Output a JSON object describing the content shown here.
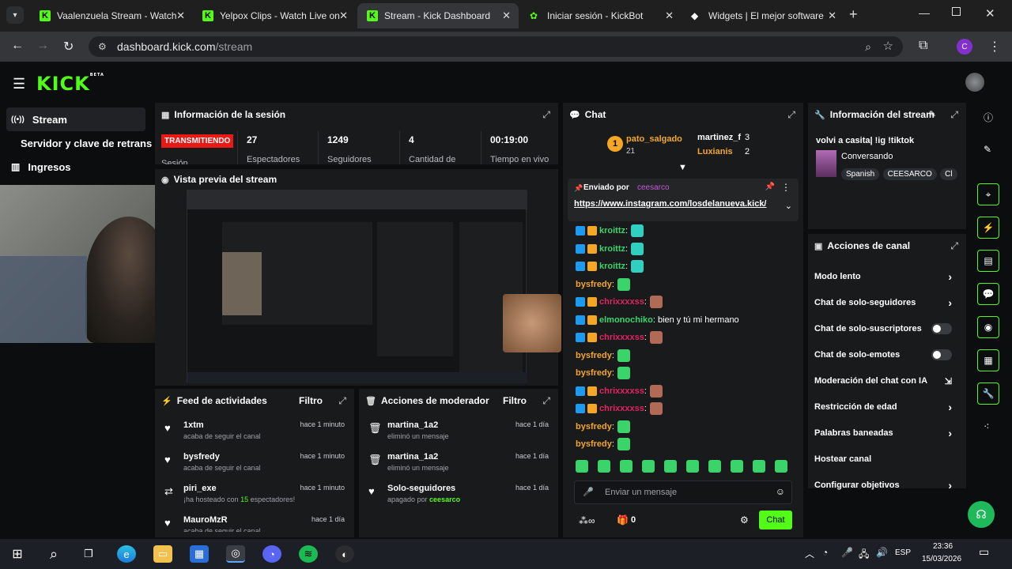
{
  "browser": {
    "tabs": [
      {
        "title": "Vaalenzuela Stream - Watch",
        "fav": "K"
      },
      {
        "title": "Yelpox Clips - Watch Live on",
        "fav": "K"
      },
      {
        "title": "Stream - Kick Dashboard",
        "fav": "K"
      },
      {
        "title": "Iniciar sesión - KickBot",
        "fav": "bot"
      },
      {
        "title": "Widgets | El mejor software",
        "fav": "w"
      }
    ],
    "url_host": "dashboard.kick.com",
    "url_path": "/stream",
    "profile_initial": "C"
  },
  "app": {
    "logo": "KICK",
    "logo_tag": "BETA"
  },
  "sidebar": {
    "items": [
      {
        "label": "Stream"
      },
      {
        "label": "Servidor y clave de retransm"
      },
      {
        "label": "Ingresos"
      }
    ]
  },
  "session": {
    "title": "Información de la sesión",
    "live_badge": "TRANSMITIENDO",
    "session_label": "Sesión",
    "stats": [
      {
        "value": "27",
        "label": "Espectadores"
      },
      {
        "value": "1249",
        "label": "Seguidores"
      },
      {
        "value": "4",
        "label": "Cantidad de"
      },
      {
        "value": "00:19:00",
        "label": "Tiempo en vivo"
      }
    ]
  },
  "preview": {
    "title": "Vista previa del stream"
  },
  "feed": {
    "title": "Feed de actividades",
    "filter": "Filtro",
    "rows": [
      {
        "name": "1xtm",
        "sub": "acaba de seguir el canal",
        "time": "hace 1 minuto"
      },
      {
        "name": "bysfredy",
        "sub": "acaba de seguir el canal",
        "time": "hace 1 minuto"
      },
      {
        "name": "piri_exe",
        "sub_pre": "¡ha hosteado con ",
        "sub_num": "15",
        "sub_post": " espectadores!",
        "time": "hace 1 minuto"
      },
      {
        "name": "MauroMzR",
        "sub": "acaba de seguir el canal",
        "time": "hace 1 día"
      }
    ]
  },
  "modactions": {
    "title": "Acciones de moderador",
    "filter": "Filtro",
    "rows": [
      {
        "name": "martina_1a2",
        "sub": "eliminó un mensaje",
        "time": "hace 1 día"
      },
      {
        "name": "martina_1a2",
        "sub": "eliminó un mensaje",
        "time": "hace 1 día"
      },
      {
        "name": "Solo-seguidores",
        "sub_pre": "apagado por ",
        "sub_user": "ceesarco",
        "time": "hace 1 día"
      }
    ]
  },
  "chat": {
    "title": "Chat",
    "top_gifter": {
      "rank": "1",
      "name": "pato_salgado",
      "count": "21"
    },
    "gifters": [
      {
        "name": "martinez_f",
        "count": "3"
      },
      {
        "name": "Luxianis",
        "count": "2"
      }
    ],
    "pinned": {
      "label": "Enviado por",
      "user": "ceesarco",
      "link": "https://www.instagram.com/losdelanueva.kick/"
    },
    "messages": [
      {
        "user": "kroittz",
        "color": "#3bd46a",
        "text": ":"
      },
      {
        "user": "kroittz",
        "color": "#3bd46a",
        "text": ":"
      },
      {
        "user": "kroittz",
        "color": "#3bd46a",
        "text": ":"
      },
      {
        "user": "bysfredy",
        "color": "#f5a623",
        "text": ":"
      },
      {
        "user": "chrixxxxss",
        "color": "#e0245e",
        "text": ":"
      },
      {
        "user": "elmonochiko",
        "color": "#3bd46a",
        "text": ": bien y tú mi hermano"
      },
      {
        "user": "chrixxxxss",
        "color": "#e0245e",
        "text": ":"
      },
      {
        "user": "bysfredy",
        "color": "#f5a623",
        "text": ":"
      },
      {
        "user": "bysfredy",
        "color": "#f5a623",
        "text": ":"
      },
      {
        "user": "chrixxxxss",
        "color": "#e0245e",
        "text": ":"
      },
      {
        "user": "chrixxxxss",
        "color": "#e0245e",
        "text": ":"
      },
      {
        "user": "bysfredy",
        "color": "#f5a623",
        "text": ":"
      },
      {
        "user": "bysfredy",
        "color": "#f5a623",
        "text": ":"
      }
    ],
    "input_placeholder": "Enviar un mensaje",
    "points": "0",
    "send_label": "Chat"
  },
  "streaminfo": {
    "title": "Información del stream",
    "stream_title": "volvi a casita| !ig !tiktok",
    "category": "Conversando",
    "tags": [
      "Spanish",
      "CEESARCO",
      "Cl"
    ]
  },
  "channelactions": {
    "title": "Acciones de canal",
    "items": [
      {
        "label": "Modo lento",
        "ctl": "chev"
      },
      {
        "label": "Chat de solo-seguidores",
        "ctl": "chev"
      },
      {
        "label": "Chat de solo-suscriptores",
        "ctl": "toggle"
      },
      {
        "label": "Chat de solo-emotes",
        "ctl": "toggle"
      },
      {
        "label": "Moderación del chat con IA",
        "ctl": "ext"
      },
      {
        "label": "Restricción de edad",
        "ctl": "chev"
      },
      {
        "label": "Palabras baneadas",
        "ctl": "chev"
      },
      {
        "label": "Hostear canal",
        "ctl": "none"
      },
      {
        "label": "Configurar objetivos",
        "ctl": "chev"
      }
    ]
  },
  "taskbar": {
    "lang": "ESP",
    "time": "23:36",
    "date": "15/03/2026"
  },
  "colors": {
    "accent": "#53fc18",
    "live": "#e91916",
    "panel": "#181a1c"
  }
}
